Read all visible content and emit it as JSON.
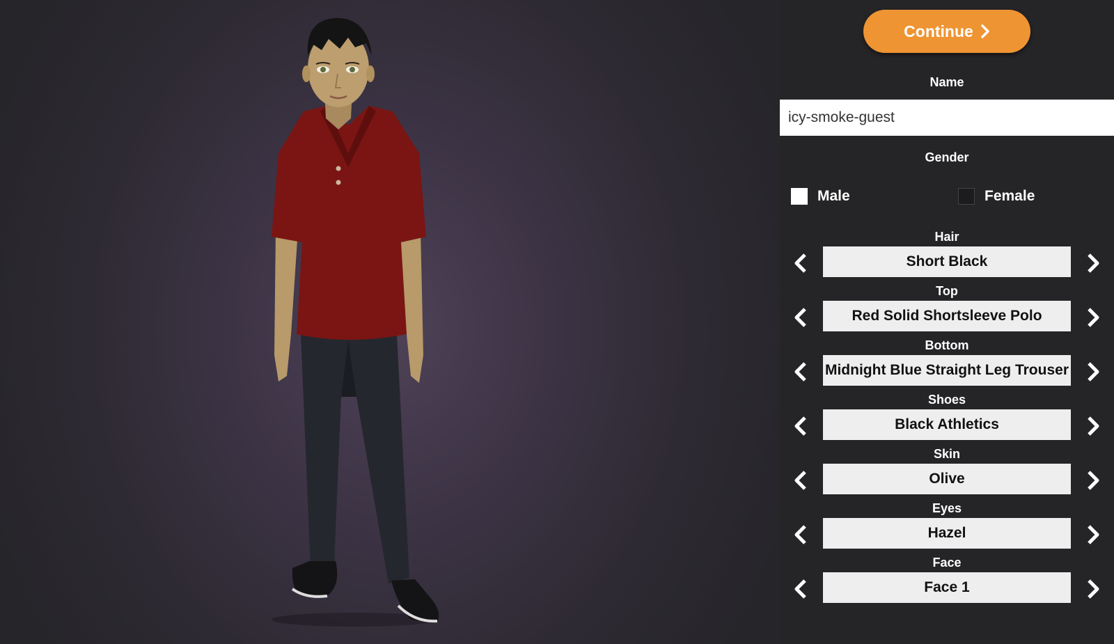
{
  "panel": {
    "continue_label": "Continue",
    "name_label": "Name",
    "name_value": "icy-smoke-guest",
    "gender_label": "Gender",
    "gender_options": [
      {
        "label": "Male",
        "checked": true
      },
      {
        "label": "Female",
        "checked": false
      }
    ],
    "selectors": [
      {
        "label": "Hair",
        "value": "Short Black"
      },
      {
        "label": "Top",
        "value": "Red Solid Shortsleeve Polo"
      },
      {
        "label": "Bottom",
        "value": "Midnight Blue Straight Leg Trouser"
      },
      {
        "label": "Shoes",
        "value": "Black Athletics"
      },
      {
        "label": "Skin",
        "value": "Olive"
      },
      {
        "label": "Eyes",
        "value": "Hazel"
      },
      {
        "label": "Face",
        "value": "Face 1"
      }
    ]
  },
  "colors": {
    "accent": "#ee9433",
    "panel_bg": "#252427",
    "value_bg": "#eeeeee"
  },
  "icons": {
    "continue": "chevron-right-icon",
    "prev": "chevron-left-icon",
    "next": "chevron-right-icon"
  }
}
